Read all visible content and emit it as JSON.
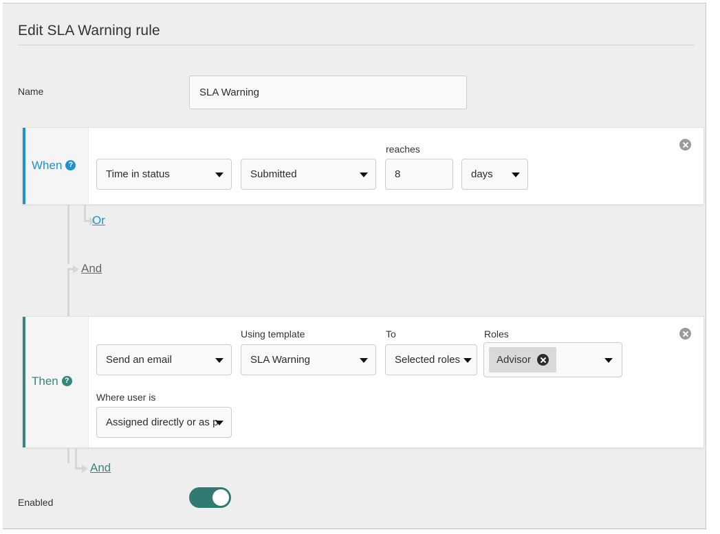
{
  "page": {
    "title": "Edit SLA Warning rule"
  },
  "name_row": {
    "label": "Name",
    "value": "SLA Warning",
    "placeholder": "Name"
  },
  "when_block": {
    "label": "When",
    "help_icon": "help-circle-icon",
    "remove_icon": "remove-circle-icon",
    "fields": [
      {
        "label": "",
        "value": "Time in status",
        "type": "select"
      },
      {
        "label": "",
        "value": "Submitted",
        "type": "select"
      },
      {
        "label": "reaches",
        "value": "8",
        "type": "text"
      },
      {
        "label": "",
        "value": "days",
        "type": "select"
      }
    ]
  },
  "or_connector": {
    "label": "Or",
    "color": "#1b93d1"
  },
  "and_connector_top": {
    "label": "And",
    "color": "#666666"
  },
  "then_block": {
    "label": "Then",
    "help_icon": "help-circle-icon",
    "remove_icon": "remove-circle-icon",
    "fields": [
      {
        "label": "",
        "value": "Send an email",
        "type": "select"
      },
      {
        "label": "Using template",
        "value": "SLA Warning",
        "type": "select"
      },
      {
        "label": "To",
        "value": "Selected roles",
        "type": "select"
      },
      {
        "label": "Roles",
        "value": "Advisor",
        "type": "chips"
      },
      {
        "label": "Where user is",
        "value": "Assigned directly or as p",
        "type": "select"
      }
    ]
  },
  "and_connector_bottom": {
    "label": "And",
    "color": "#35867d"
  },
  "enabled_row": {
    "label": "Enabled",
    "state": "on"
  },
  "colors": {
    "when_accent": "#1b93d1",
    "then_accent": "#35867d",
    "toggle_on": "#2f7a71",
    "page_background": "#eeeeee",
    "panel_background": "#ffffff"
  }
}
